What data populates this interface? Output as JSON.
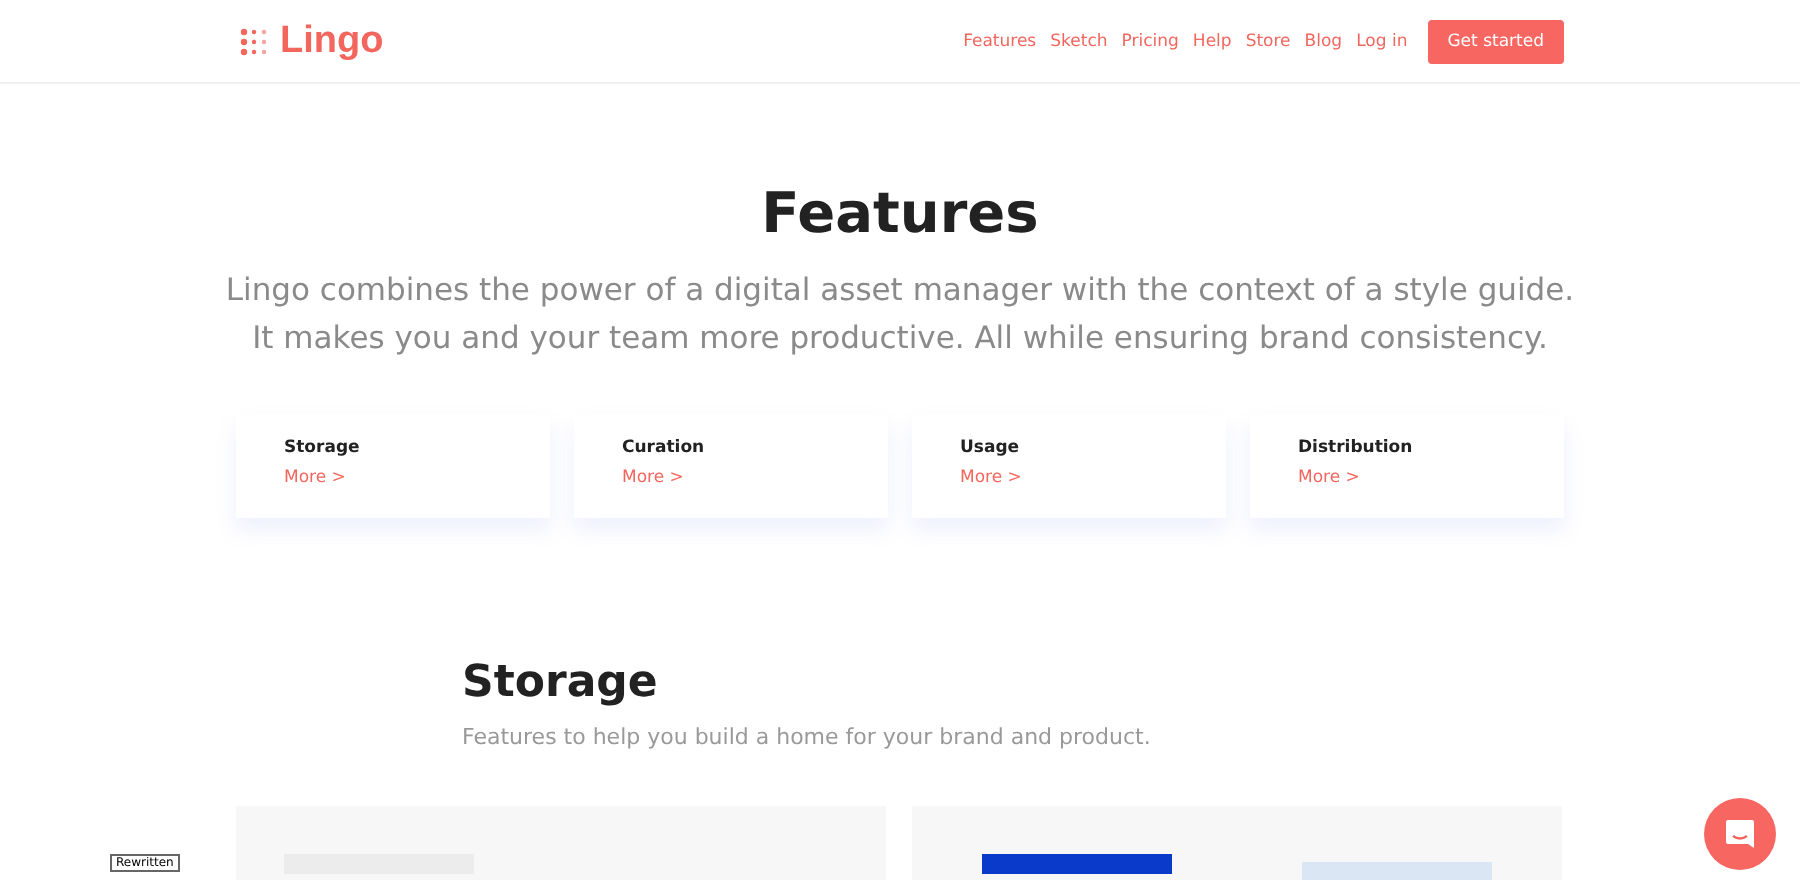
{
  "brand": "Lingo",
  "nav": [
    "Features",
    "Sketch",
    "Pricing",
    "Help",
    "Store",
    "Blog",
    "Log in"
  ],
  "cta": "Get started",
  "hero": {
    "title": "Features",
    "lines": [
      "Lingo combines the power of a digital asset manager with the context of a style guide.",
      "It makes you and your team more productive. All while ensuring brand consistency."
    ]
  },
  "cards": [
    {
      "title": "Storage",
      "link": "More >"
    },
    {
      "title": "Curation",
      "link": "More >"
    },
    {
      "title": "Usage",
      "link": "More >"
    },
    {
      "title": "Distribution",
      "link": "More >"
    }
  ],
  "section": {
    "title": "Storage",
    "subtitle": "Features to help you build a home for your brand and product."
  },
  "tag": "Rewritten"
}
